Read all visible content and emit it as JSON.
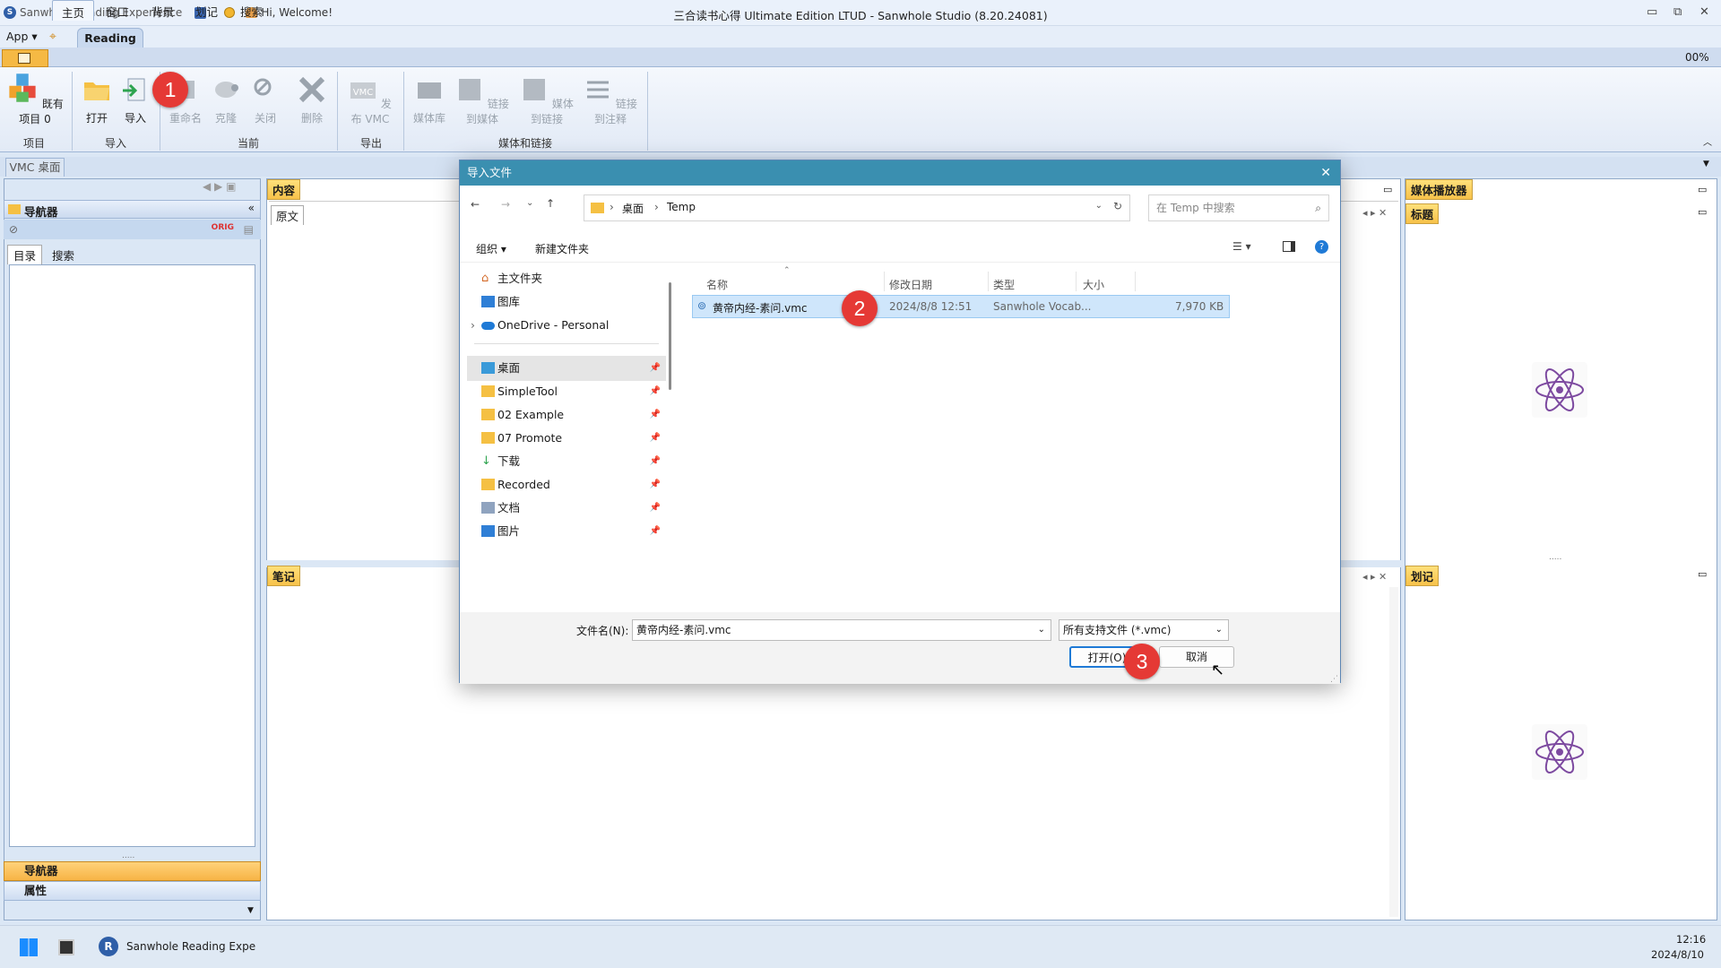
{
  "titlebar": {
    "app_name": "Sanwhole Reading Experience",
    "welcome": "Hi, Welcome!",
    "window_title": "三合读书心得 Ultimate Edition LTUD - Sanwhole Studio (8.20.24081)"
  },
  "menu": {
    "app": "App",
    "reading_tab": "Reading"
  },
  "ribbon_tabs": [
    "主页",
    "窗口",
    "背景",
    "划记",
    "搜索"
  ],
  "zoom": "00%",
  "ribbon": {
    "existing_items": "既有项目",
    "existing_count": "0",
    "open": "打开",
    "import": "导入",
    "rename": "重命名",
    "clone": "克隆",
    "close": "关闭",
    "delete": "删除",
    "publish_vmc": "发布 VMC",
    "media_lib": "媒体库",
    "link_to_media": "链接到媒体",
    "media_to_link": "媒体到链接",
    "link_to_note": "链接到注释",
    "groups": {
      "project": "项目",
      "import": "导入",
      "current": "当前",
      "export": "导出",
      "media_links": "媒体和链接"
    }
  },
  "vmc_tab": "VMC 桌面",
  "navigator": {
    "title": "导航器",
    "tabs": [
      "目录",
      "搜索"
    ],
    "bottom_nav": "导航器",
    "bottom_props": "属性"
  },
  "content": {
    "title": "内容",
    "tab_original": "原文",
    "notes_title": "笔记"
  },
  "media_player": {
    "title": "媒体播放器",
    "sub_title": "标题",
    "highlight_title": "划记"
  },
  "dialog": {
    "title": "导入文件",
    "breadcrumb": [
      "桌面",
      "Temp"
    ],
    "search_placeholder": "在 Temp 中搜索",
    "organize": "组织",
    "new_folder": "新建文件夹",
    "tree": [
      {
        "label": "主文件夹",
        "icon": "home-icon",
        "pinned": false
      },
      {
        "label": "图库",
        "icon": "gallery-icon",
        "pinned": false
      },
      {
        "label": "OneDrive - Personal",
        "icon": "cloud-icon",
        "pinned": false
      },
      {
        "label": "桌面",
        "icon": "desktop-icon",
        "pinned": true
      },
      {
        "label": "SimpleTool",
        "icon": "folder-icon",
        "pinned": true
      },
      {
        "label": "02 Example",
        "icon": "folder-icon",
        "pinned": true
      },
      {
        "label": "07 Promote",
        "icon": "folder-icon",
        "pinned": true
      },
      {
        "label": "下载",
        "icon": "download-icon",
        "pinned": true
      },
      {
        "label": "Recorded",
        "icon": "folder-icon",
        "pinned": true
      },
      {
        "label": "文档",
        "icon": "document-icon",
        "pinned": true
      },
      {
        "label": "图片",
        "icon": "picture-icon",
        "pinned": true
      }
    ],
    "columns": [
      "名称",
      "修改日期",
      "类型",
      "大小"
    ],
    "files": [
      {
        "name": "黄帝内经-素问.vmc",
        "date": "2024/8/8 12:51",
        "type": "Sanwhole Vocab...",
        "size": "7,970 KB"
      }
    ],
    "filename_label": "文件名(N):",
    "filename_value": "黄帝内经-素问.vmc",
    "filter": "所有支持文件 (*.vmc)",
    "open_button": "打开(O)",
    "cancel_button": "取消"
  },
  "annotations": [
    "1",
    "2",
    "3"
  ],
  "taskbar": {
    "app_label": "Sanwhole Reading Expe",
    "time": "12:16",
    "date": "2024/8/10"
  },
  "colors": {
    "dialog_title": "#3a8fb0",
    "orange_title": "#f7c24a",
    "badge": "#e53935",
    "selection": "#cfe6fb"
  }
}
